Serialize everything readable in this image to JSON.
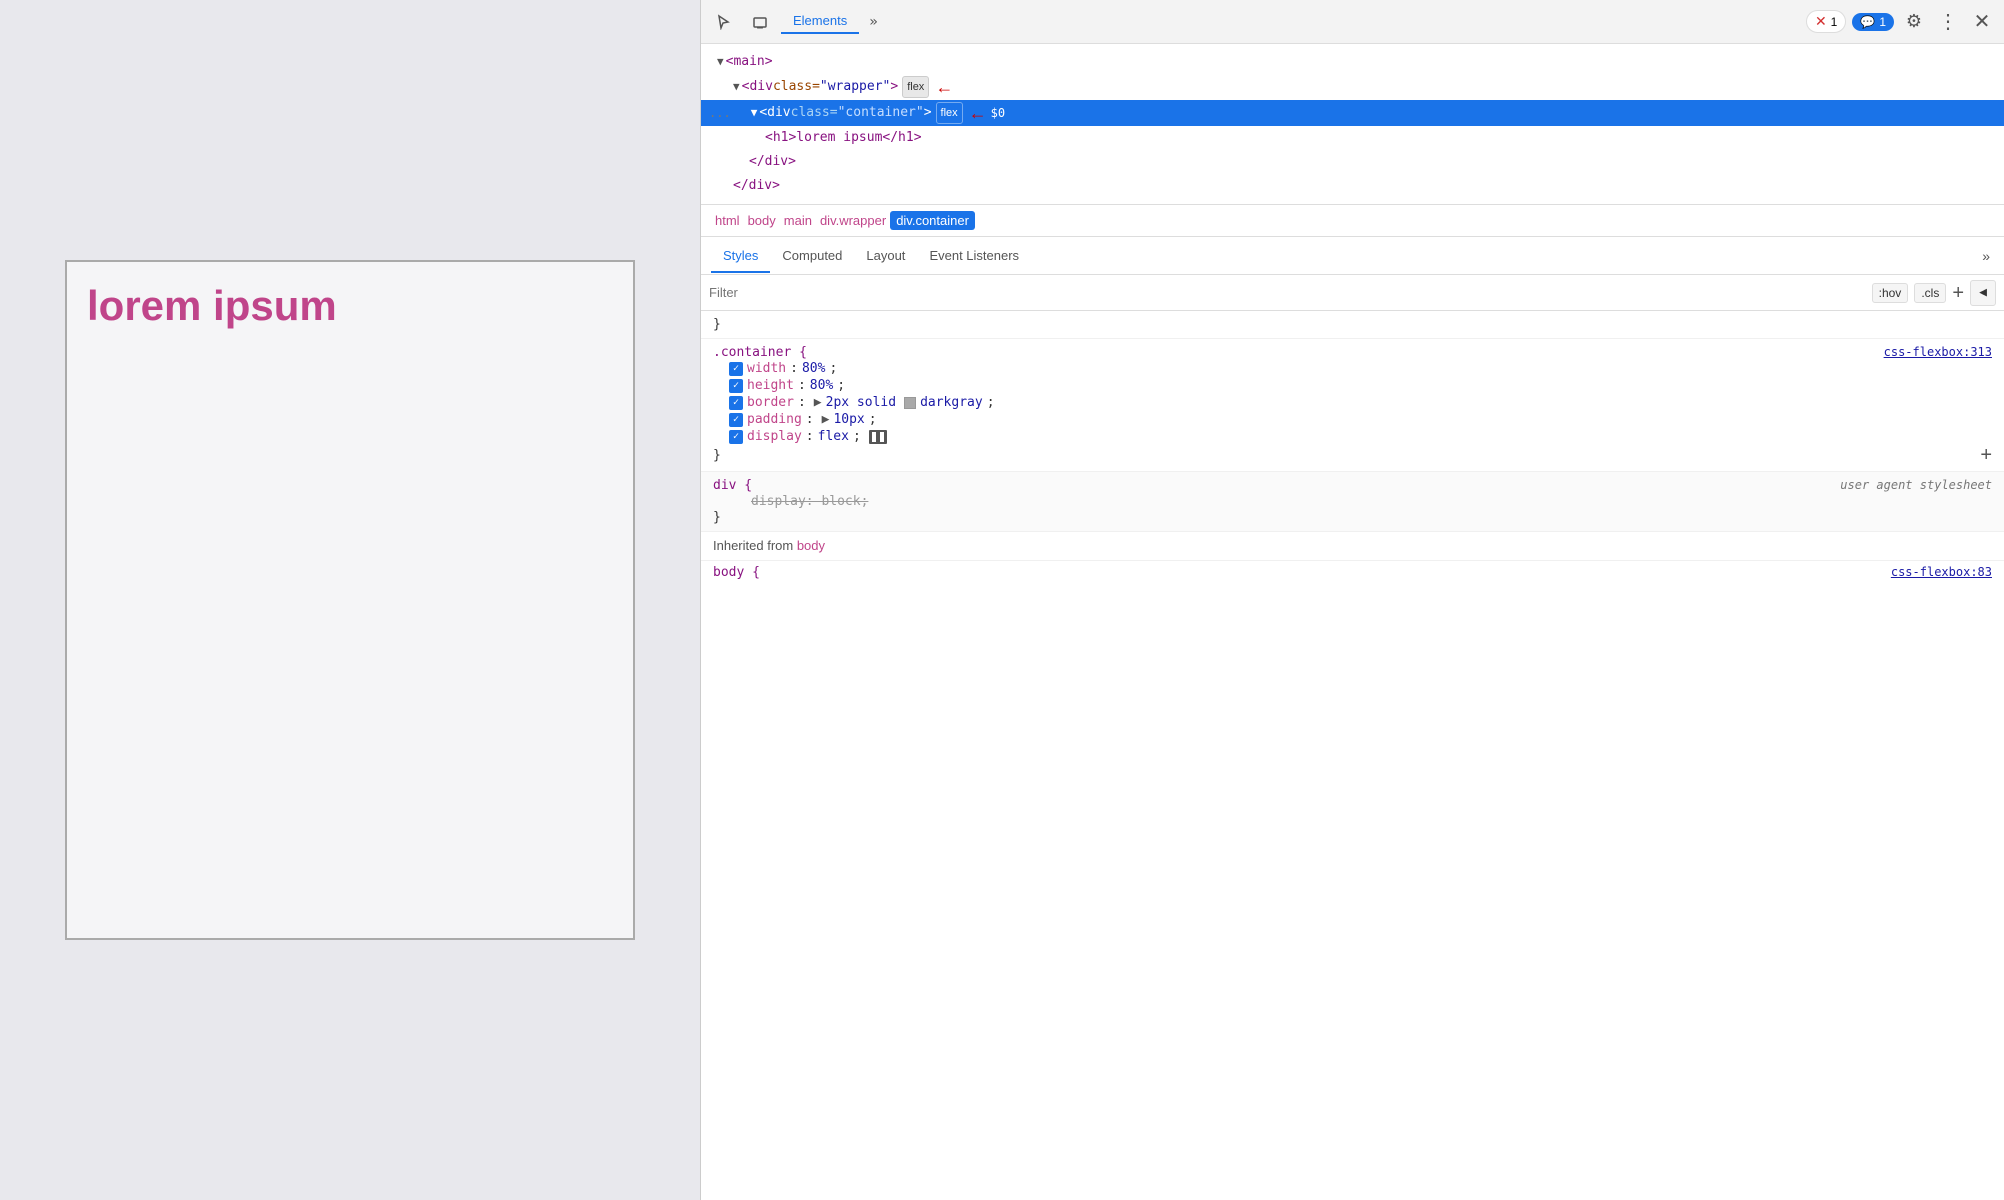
{
  "viewport": {
    "demo_text": "lorem ipsum"
  },
  "devtools": {
    "toolbar": {
      "inspect_icon": "⬡",
      "device_icon": "▭",
      "elements_tab": "Elements",
      "more_tabs_icon": "»",
      "error_count": "1",
      "message_count": "1",
      "gear_icon": "⚙",
      "dots_icon": "⋮",
      "close_icon": "✕"
    },
    "dom_tree": {
      "main_tag": "<main>",
      "wrapper_tag": "<div class=\"wrapper\">",
      "wrapper_flex": "flex",
      "container_tag": "<div class=\"container\">",
      "container_flex": "flex",
      "h1_tag": "<h1>lorem ipsum</h1>",
      "div_close": "</div>",
      "div_close2": "</div>",
      "dots": "..."
    },
    "breadcrumb": {
      "items": [
        "html",
        "body",
        "main",
        "div.wrapper",
        "div.container"
      ]
    },
    "styles_panel": {
      "tabs": [
        "Styles",
        "Computed",
        "Layout",
        "Event Listeners"
      ],
      "more_icon": "»",
      "filter_placeholder": "Filter",
      "hov_btn": ":hov",
      "cls_btn": ".cls",
      "plus_btn": "+",
      "arrow_btn": "◀"
    },
    "css_rules": {
      "container_rule": {
        "selector": ".container {",
        "source": "css-flexbox:313",
        "properties": [
          {
            "checked": true,
            "name": "width",
            "colon": ":",
            "value": "80%",
            "semicolon": ";"
          },
          {
            "checked": true,
            "name": "height",
            "colon": ":",
            "value": "80%",
            "semicolon": ";"
          },
          {
            "checked": true,
            "name": "border",
            "colon": ":",
            "value": "2px solid",
            "color": "darkgray",
            "semicolon": ";"
          },
          {
            "checked": true,
            "name": "padding",
            "colon": ":",
            "value": "10px",
            "semicolon": ";"
          },
          {
            "checked": true,
            "name": "display",
            "colon": ":",
            "value": "flex",
            "semicolon": ";"
          }
        ],
        "close": "}"
      },
      "div_rule": {
        "selector": "div {",
        "source": "user agent stylesheet",
        "properties": [
          {
            "checked": false,
            "name": "display",
            "colon": ":",
            "value": "block",
            "semicolon": ";",
            "strikethrough": true
          }
        ],
        "close": "}"
      },
      "inherited_label": "Inherited from",
      "inherited_element": "body",
      "body_rule": "body {"
    }
  }
}
